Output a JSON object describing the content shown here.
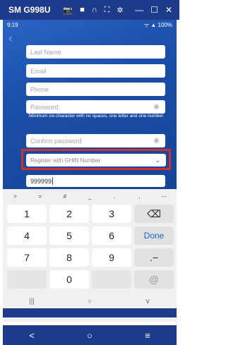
{
  "window": {
    "title": "SM G998U",
    "icons": [
      "camera-icon",
      "video-icon",
      "headset-icon",
      "fullscreen-icon",
      "settings-icon"
    ],
    "controls": [
      "minimize-icon",
      "maximize-icon",
      "close-icon"
    ]
  },
  "statusbar": {
    "time": "9:19",
    "battery": "100%"
  },
  "form": {
    "last_name_placeholder": "Last Name",
    "email_placeholder": "Email",
    "phone_placeholder": "Phone",
    "password_placeholder": "Password",
    "password_hint": "Minimum six-character with no spaces, one letter and one number.",
    "confirm_password_placeholder": "Confirm password",
    "register_select_value": "Register with GHIN Number",
    "ghin_value": "999999"
  },
  "keyboard": {
    "symbols": [
      ">",
      "=",
      "#",
      "_",
      ".",
      ",",
      "⋯"
    ],
    "rows": [
      [
        "1",
        "2",
        "3",
        "⌫"
      ],
      [
        "4",
        "5",
        "6",
        "Done"
      ],
      [
        "7",
        "8",
        "9",
        ".−"
      ],
      [
        "",
        "0",
        "",
        "@"
      ]
    ]
  },
  "gesture_bar": [
    "|||",
    "○",
    "∨"
  ],
  "nav": [
    "<",
    "○",
    "≡"
  ],
  "colors": {
    "app_blue": "#1a4ea8",
    "highlight_red": "#d32f2f",
    "done_blue": "#1a66d0"
  }
}
